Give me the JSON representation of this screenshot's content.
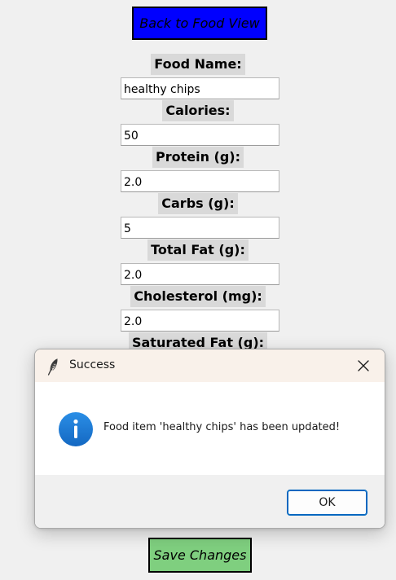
{
  "main": {
    "back_button_label": "Back to Food View",
    "save_button_label": "Save Changes",
    "fields": [
      {
        "label": "Food Name:",
        "value": "healthy chips"
      },
      {
        "label": "Calories:",
        "value": "50"
      },
      {
        "label": "Protein (g):",
        "value": "2.0"
      },
      {
        "label": "Carbs (g):",
        "value": "5"
      },
      {
        "label": "Total Fat (g):",
        "value": "2.0"
      },
      {
        "label": "Cholesterol (mg):",
        "value": "2.0"
      },
      {
        "label": "Saturated Fat (g):"
      }
    ]
  },
  "dialog": {
    "title": "Success",
    "message": "Food item 'healthy chips' has been updated!",
    "ok_label": "OK",
    "title_icon": "feather-icon",
    "message_icon": "info-icon",
    "close_icon": "close-icon"
  },
  "colors": {
    "back_button": "#0000ff",
    "save_button": "#7fcf7f",
    "label_background": "#d9d9d9",
    "window_background": "#f0f0f0",
    "dialog_titlebar": "#f9f1ea",
    "info_icon": "#1a7fd6",
    "ok_button_border": "#0067c0"
  }
}
